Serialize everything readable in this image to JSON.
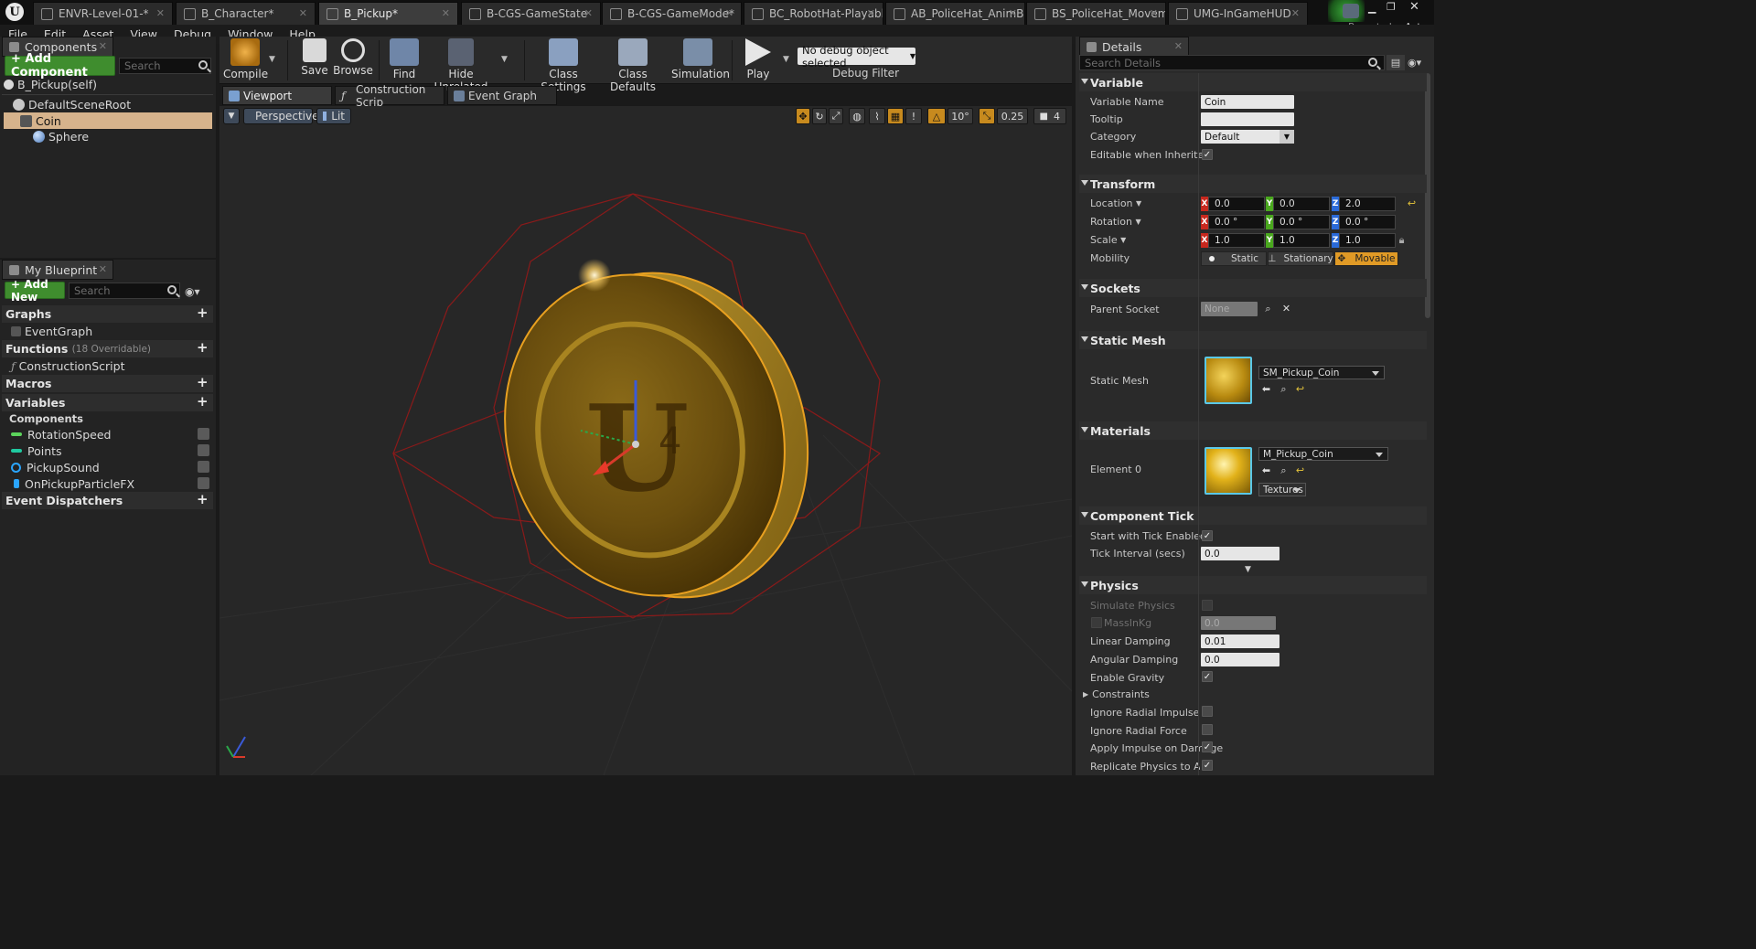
{
  "doc_tabs": [
    {
      "label": "ENVR-Level-01-*",
      "active": false
    },
    {
      "label": "B_Character*",
      "active": false
    },
    {
      "label": "B_Pickup*",
      "active": true
    },
    {
      "label": "B-CGS-GameState",
      "active": false
    },
    {
      "label": "B-CGS-GameMode*",
      "active": false
    },
    {
      "label": "BC_RobotHat-PlayableCh",
      "active": false
    },
    {
      "label": "AB_PoliceHat_AnimBluep",
      "active": false
    },
    {
      "label": "BS_PoliceHat_Movement",
      "active": false
    },
    {
      "label": "UMG-InGameHUD",
      "active": false
    }
  ],
  "parent_class": {
    "label": "Parent class:",
    "value": "Actor"
  },
  "menu": [
    "File",
    "Edit",
    "Asset",
    "View",
    "Debug",
    "Window",
    "Help"
  ],
  "components": {
    "tab": "Components",
    "add_button": "+ Add Component",
    "search_placeholder": "Search",
    "self": "B_Pickup(self)",
    "tree": [
      "DefaultSceneRoot",
      "Coin",
      "Sphere"
    ]
  },
  "my_blueprint": {
    "tab": "My Blueprint",
    "add_new": "+ Add New",
    "search_placeholder": "Search",
    "graphs": "Graphs",
    "event_graph": "EventGraph",
    "functions": "Functions",
    "functions_note": "(18 Overridable)",
    "construction": "ConstructionScript",
    "macros": "Macros",
    "variables": "Variables",
    "components": "Components",
    "vars": [
      {
        "name": "RotationSpeed",
        "color": "#5cd45c"
      },
      {
        "name": "Points",
        "color": "#1fc9a0"
      },
      {
        "name": "PickupSound",
        "color": "#2aa5ff"
      },
      {
        "name": "OnPickupParticleFX",
        "color": "#2aa5ff"
      }
    ],
    "dispatchers": "Event Dispatchers"
  },
  "toolbar": {
    "compile": "Compile",
    "save": "Save",
    "browse": "Browse",
    "find": "Find",
    "hide_unrelated": "Hide Unrelated",
    "class_settings": "Class Settings",
    "class_defaults": "Class Defaults",
    "simulation": "Simulation",
    "play": "Play",
    "debug_select": "No debug object selected",
    "debug_filter": "Debug Filter"
  },
  "editor_tabs": [
    "Viewport",
    "Construction Scrip",
    "Event Graph"
  ],
  "viewport": {
    "perspective": "Perspective",
    "lit": "Lit",
    "grid_angle": "10°",
    "scale_snap": "0.25",
    "cam_speed": "4"
  },
  "details": {
    "tab": "Details",
    "search_placeholder": "Search Details",
    "variable": {
      "title": "Variable",
      "name_label": "Variable Name",
      "name": "Coin",
      "tooltip_label": "Tooltip",
      "tooltip": "",
      "category_label": "Category",
      "category": "Default",
      "editable_label": "Editable when Inherited"
    },
    "transform": {
      "title": "Transform",
      "location": "Location",
      "rotation": "Rotation",
      "scale": "Scale",
      "mobility": "Mobility",
      "loc": [
        "0.0",
        "0.0",
        "2.0"
      ],
      "rot": [
        "0.0 °",
        "0.0 °",
        "0.0 °"
      ],
      "scl": [
        "1.0",
        "1.0",
        "1.0"
      ],
      "mob": [
        "Static",
        "Stationary",
        "Movable"
      ]
    },
    "sockets": {
      "title": "Sockets",
      "parent_label": "Parent Socket",
      "parent": "None"
    },
    "static_mesh": {
      "title": "Static Mesh",
      "label": "Static Mesh",
      "value": "SM_Pickup_Coin"
    },
    "materials": {
      "title": "Materials",
      "label": "Element 0",
      "value": "M_Pickup_Coin",
      "textures": "Textures"
    },
    "tick": {
      "title": "Component Tick",
      "start_label": "Start with Tick Enabled",
      "interval_label": "Tick Interval (secs)",
      "interval": "0.0"
    },
    "physics": {
      "title": "Physics",
      "simulate": "Simulate Physics",
      "mass_label": "MassInKg",
      "mass": "0.0",
      "linear_label": "Linear Damping",
      "linear": "0.01",
      "angular_label": "Angular Damping",
      "angular": "0.0",
      "gravity": "Enable Gravity",
      "constraints": "Constraints",
      "radial_impulse": "Ignore Radial Impulse",
      "radial_force": "Ignore Radial Force",
      "impulse_damage": "Apply Impulse on Damage",
      "replicate": "Replicate Physics to Autonor"
    }
  }
}
